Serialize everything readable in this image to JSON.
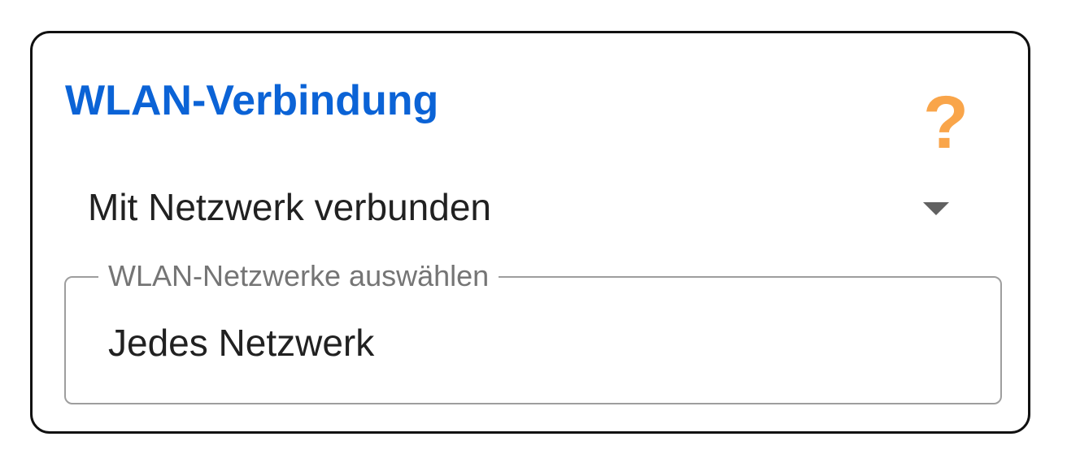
{
  "card": {
    "title": "WLAN-Verbindung",
    "help_icon": {
      "name": "question-mark-icon",
      "glyph": "?"
    },
    "connection_dropdown": {
      "selected": "Mit Netzwerk verbunden",
      "arrow_icon": "dropdown-arrow-icon"
    },
    "network_field": {
      "label": "WLAN-Netzwerke auswählen",
      "value": "Jedes Netzwerk"
    }
  },
  "colors": {
    "title": "#0b63d6",
    "help_icon": "#f9a54a",
    "border": "#111111",
    "field_border": "#9e9e9e",
    "text": "#212121",
    "label": "#757575",
    "arrow": "#616161"
  }
}
